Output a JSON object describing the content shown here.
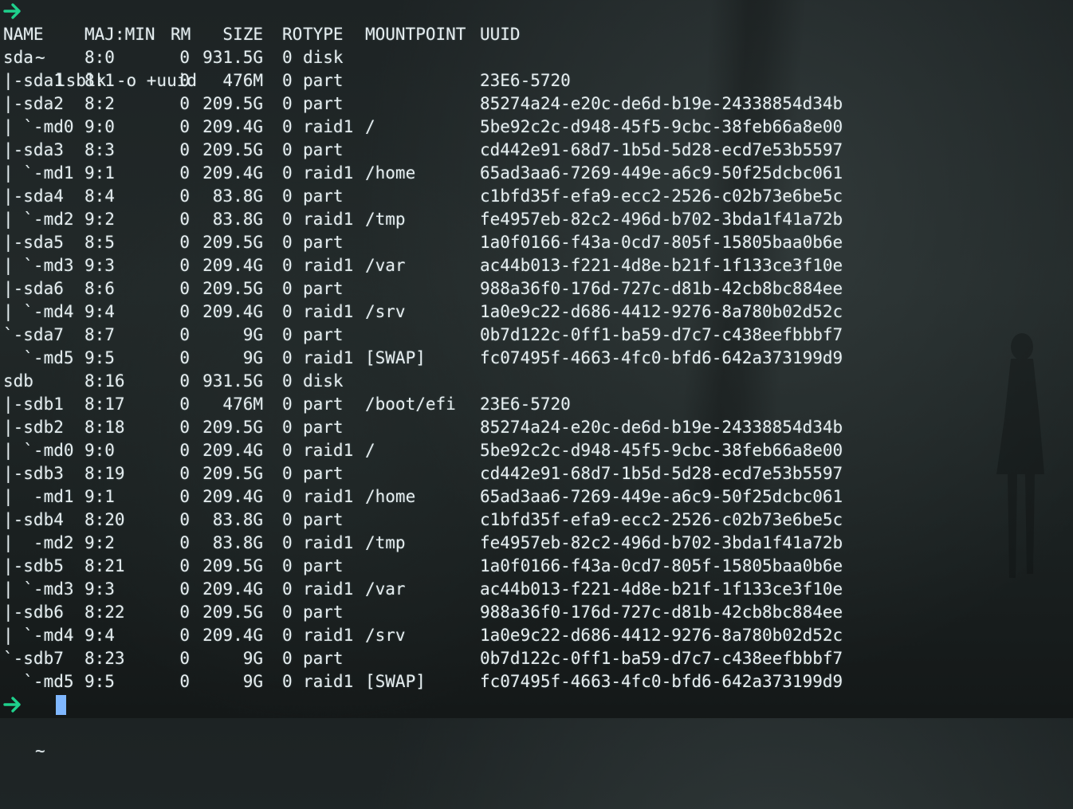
{
  "terminal": {
    "prompt_symbol": "~",
    "command": "lsblk -o +uuid",
    "accent_color": "#1fd08c",
    "cursor_color": "#7fb7ff",
    "headers": {
      "name": "NAME",
      "majmin": "MAJ:MIN",
      "rm": "RM",
      "size": "SIZE",
      "ro": "RO",
      "type": "TYPE",
      "mountpoint": "MOUNTPOINT",
      "uuid": "UUID"
    },
    "rows": [
      {
        "name": "sda",
        "majmin": "8:0",
        "rm": "0",
        "size": "931.5G",
        "ro": "0",
        "type": "disk",
        "mountpoint": "",
        "uuid": ""
      },
      {
        "name": "|-sda1",
        "majmin": "8:1",
        "rm": "0",
        "size": "476M",
        "ro": "0",
        "type": "part",
        "mountpoint": "",
        "uuid": "23E6-5720"
      },
      {
        "name": "|-sda2",
        "majmin": "8:2",
        "rm": "0",
        "size": "209.5G",
        "ro": "0",
        "type": "part",
        "mountpoint": "",
        "uuid": "85274a24-e20c-de6d-b19e-24338854d34b"
      },
      {
        "name": "| `-md0",
        "majmin": "9:0",
        "rm": "0",
        "size": "209.4G",
        "ro": "0",
        "type": "raid1",
        "mountpoint": "/",
        "uuid": "5be92c2c-d948-45f5-9cbc-38feb66a8e00"
      },
      {
        "name": "|-sda3",
        "majmin": "8:3",
        "rm": "0",
        "size": "209.5G",
        "ro": "0",
        "type": "part",
        "mountpoint": "",
        "uuid": "cd442e91-68d7-1b5d-5d28-ecd7e53b5597"
      },
      {
        "name": "| `-md1",
        "majmin": "9:1",
        "rm": "0",
        "size": "209.4G",
        "ro": "0",
        "type": "raid1",
        "mountpoint": "/home",
        "uuid": "65ad3aa6-7269-449e-a6c9-50f25dcbc061"
      },
      {
        "name": "|-sda4",
        "majmin": "8:4",
        "rm": "0",
        "size": "83.8G",
        "ro": "0",
        "type": "part",
        "mountpoint": "",
        "uuid": "c1bfd35f-efa9-ecc2-2526-c02b73e6be5c"
      },
      {
        "name": "| `-md2",
        "majmin": "9:2",
        "rm": "0",
        "size": "83.8G",
        "ro": "0",
        "type": "raid1",
        "mountpoint": "/tmp",
        "uuid": "fe4957eb-82c2-496d-b702-3bda1f41a72b"
      },
      {
        "name": "|-sda5",
        "majmin": "8:5",
        "rm": "0",
        "size": "209.5G",
        "ro": "0",
        "type": "part",
        "mountpoint": "",
        "uuid": "1a0f0166-f43a-0cd7-805f-15805baa0b6e"
      },
      {
        "name": "| `-md3",
        "majmin": "9:3",
        "rm": "0",
        "size": "209.4G",
        "ro": "0",
        "type": "raid1",
        "mountpoint": "/var",
        "uuid": "ac44b013-f221-4d8e-b21f-1f133ce3f10e"
      },
      {
        "name": "|-sda6",
        "majmin": "8:6",
        "rm": "0",
        "size": "209.5G",
        "ro": "0",
        "type": "part",
        "mountpoint": "",
        "uuid": "988a36f0-176d-727c-d81b-42cb8bc884ee"
      },
      {
        "name": "| `-md4",
        "majmin": "9:4",
        "rm": "0",
        "size": "209.4G",
        "ro": "0",
        "type": "raid1",
        "mountpoint": "/srv",
        "uuid": "1a0e9c22-d686-4412-9276-8a780b02d52c"
      },
      {
        "name": "`-sda7",
        "majmin": "8:7",
        "rm": "0",
        "size": "9G",
        "ro": "0",
        "type": "part",
        "mountpoint": "",
        "uuid": "0b7d122c-0ff1-ba59-d7c7-c438eefbbbf7"
      },
      {
        "name": "  `-md5",
        "majmin": "9:5",
        "rm": "0",
        "size": "9G",
        "ro": "0",
        "type": "raid1",
        "mountpoint": "[SWAP]",
        "uuid": "fc07495f-4663-4fc0-bfd6-642a373199d9"
      },
      {
        "name": "sdb",
        "majmin": "8:16",
        "rm": "0",
        "size": "931.5G",
        "ro": "0",
        "type": "disk",
        "mountpoint": "",
        "uuid": ""
      },
      {
        "name": "|-sdb1",
        "majmin": "8:17",
        "rm": "0",
        "size": "476M",
        "ro": "0",
        "type": "part",
        "mountpoint": "/boot/efi",
        "uuid": "23E6-5720"
      },
      {
        "name": "|-sdb2",
        "majmin": "8:18",
        "rm": "0",
        "size": "209.5G",
        "ro": "0",
        "type": "part",
        "mountpoint": "",
        "uuid": "85274a24-e20c-de6d-b19e-24338854d34b"
      },
      {
        "name": "| `-md0",
        "majmin": "9:0",
        "rm": "0",
        "size": "209.4G",
        "ro": "0",
        "type": "raid1",
        "mountpoint": "/",
        "uuid": "5be92c2c-d948-45f5-9cbc-38feb66a8e00"
      },
      {
        "name": "|-sdb3",
        "majmin": "8:19",
        "rm": "0",
        "size": "209.5G",
        "ro": "0",
        "type": "part",
        "mountpoint": "",
        "uuid": "cd442e91-68d7-1b5d-5d28-ecd7e53b5597"
      },
      {
        "name": "|  -md1",
        "majmin": "9:1",
        "rm": "0",
        "size": "209.4G",
        "ro": "0",
        "type": "raid1",
        "mountpoint": "/home",
        "uuid": "65ad3aa6-7269-449e-a6c9-50f25dcbc061"
      },
      {
        "name": "|-sdb4",
        "majmin": "8:20",
        "rm": "0",
        "size": "83.8G",
        "ro": "0",
        "type": "part",
        "mountpoint": "",
        "uuid": "c1bfd35f-efa9-ecc2-2526-c02b73e6be5c"
      },
      {
        "name": "|  -md2",
        "majmin": "9:2",
        "rm": "0",
        "size": "83.8G",
        "ro": "0",
        "type": "raid1",
        "mountpoint": "/tmp",
        "uuid": "fe4957eb-82c2-496d-b702-3bda1f41a72b"
      },
      {
        "name": "|-sdb5",
        "majmin": "8:21",
        "rm": "0",
        "size": "209.5G",
        "ro": "0",
        "type": "part",
        "mountpoint": "",
        "uuid": "1a0f0166-f43a-0cd7-805f-15805baa0b6e"
      },
      {
        "name": "| `-md3",
        "majmin": "9:3",
        "rm": "0",
        "size": "209.4G",
        "ro": "0",
        "type": "raid1",
        "mountpoint": "/var",
        "uuid": "ac44b013-f221-4d8e-b21f-1f133ce3f10e"
      },
      {
        "name": "|-sdb6",
        "majmin": "8:22",
        "rm": "0",
        "size": "209.5G",
        "ro": "0",
        "type": "part",
        "mountpoint": "",
        "uuid": "988a36f0-176d-727c-d81b-42cb8bc884ee"
      },
      {
        "name": "| `-md4",
        "majmin": "9:4",
        "rm": "0",
        "size": "209.4G",
        "ro": "0",
        "type": "raid1",
        "mountpoint": "/srv",
        "uuid": "1a0e9c22-d686-4412-9276-8a780b02d52c"
      },
      {
        "name": "`-sdb7",
        "majmin": "8:23",
        "rm": "0",
        "size": "9G",
        "ro": "0",
        "type": "part",
        "mountpoint": "",
        "uuid": "0b7d122c-0ff1-ba59-d7c7-c438eefbbbf7"
      },
      {
        "name": "  `-md5",
        "majmin": "9:5",
        "rm": "0",
        "size": "9G",
        "ro": "0",
        "type": "raid1",
        "mountpoint": "[SWAP]",
        "uuid": "fc07495f-4663-4fc0-bfd6-642a373199d9"
      }
    ]
  }
}
